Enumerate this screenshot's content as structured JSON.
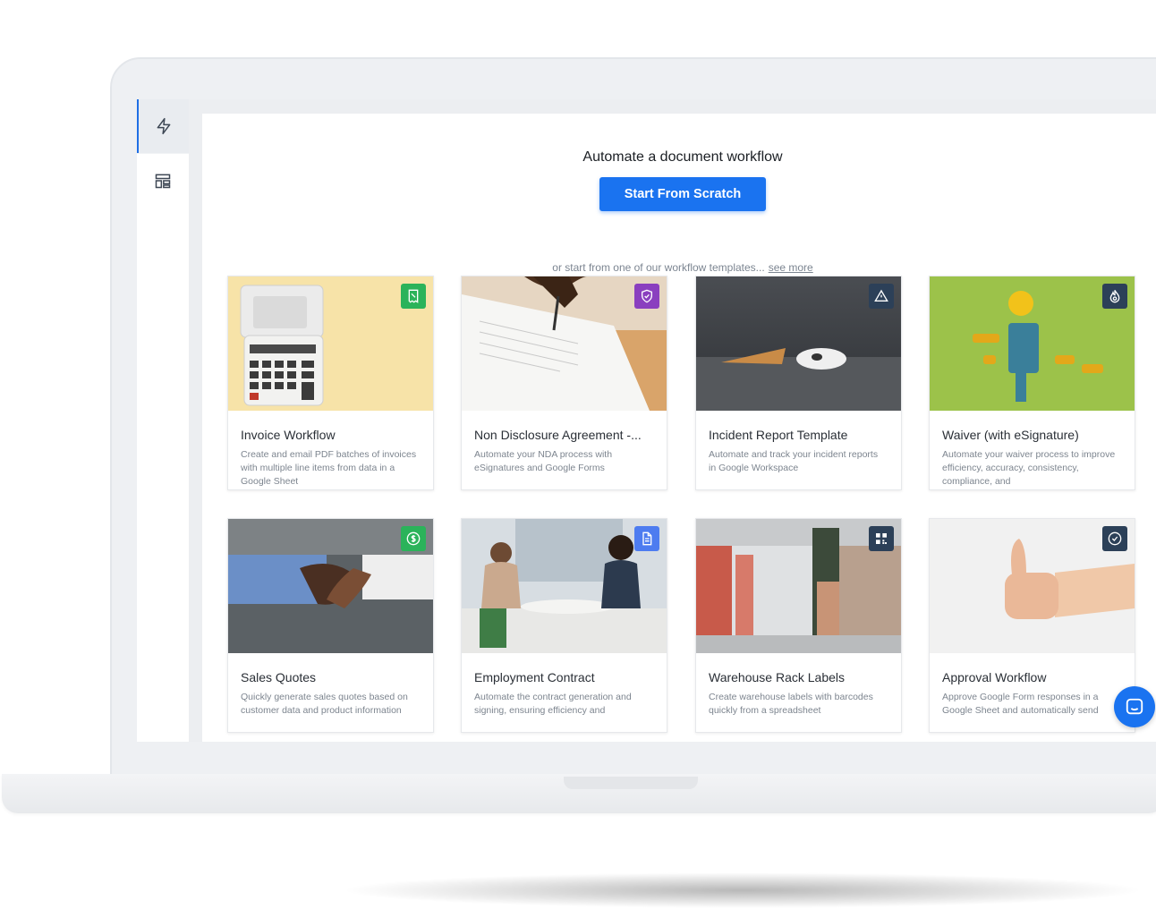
{
  "header": {
    "title": "Automate a document workflow",
    "cta_label": "Start From Scratch",
    "subtext": "or start from one of our workflow templates...",
    "see_more": "see more"
  },
  "colors": {
    "accent": "#1a73f0",
    "sidebar_active": "#1f6fe5"
  },
  "sidebar": {
    "items": [
      {
        "icon": "lightning-icon",
        "active": true
      },
      {
        "icon": "layout-icon",
        "active": false
      }
    ]
  },
  "templates": [
    {
      "title": "Invoice Workflow",
      "description": "Create and email PDF batches of invoices with multiple line items from data in a Google Sheet",
      "badge_icon": "receipt-icon",
      "badge_color": "#2bb35a"
    },
    {
      "title": "Non Disclosure Agreement -...",
      "description": "Automate your NDA process with eSignatures and Google Forms",
      "badge_icon": "shield-check-icon",
      "badge_color": "#8a3fbf"
    },
    {
      "title": "Incident Report Template",
      "description": "Automate and track your incident reports in Google Workspace",
      "badge_icon": "warning-icon",
      "badge_color": "#2c4058"
    },
    {
      "title": "Waiver (with eSignature)",
      "description": "Automate your waiver process to improve efficiency, accuracy, consistency, compliance, and",
      "badge_icon": "fire-icon",
      "badge_color": "#2c4058"
    },
    {
      "title": "Sales Quotes",
      "description": "Quickly generate sales quotes based on customer data and product information",
      "badge_icon": "dollar-icon",
      "badge_color": "#2bb35a"
    },
    {
      "title": "Employment Contract",
      "description": "Automate the contract generation and signing, ensuring efficiency and",
      "badge_icon": "document-icon",
      "badge_color": "#4d7cf0"
    },
    {
      "title": "Warehouse Rack Labels",
      "description": "Create warehouse labels with barcodes quickly from a spreadsheet",
      "badge_icon": "qr-code-icon",
      "badge_color": "#2c4058"
    },
    {
      "title": "Approval Workflow",
      "description": "Approve Google Form responses in a Google Sheet and automatically send",
      "badge_icon": "check-circle-icon",
      "badge_color": "#2c4058"
    }
  ],
  "chat": {
    "icon": "chat-icon"
  }
}
